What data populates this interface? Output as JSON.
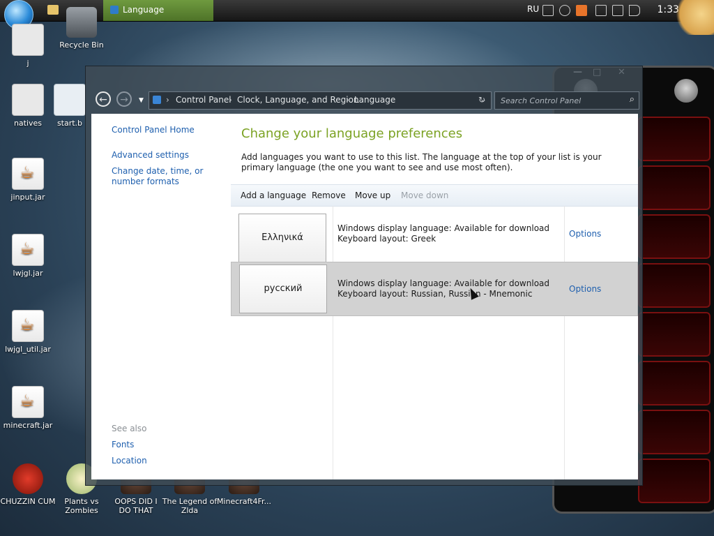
{
  "taskbar": {
    "active_task": "Language",
    "tray_language": "RU",
    "clock": "1:33 AM"
  },
  "desktop": {
    "icons": [
      {
        "label": "j"
      },
      {
        "label": "Recycle Bin"
      },
      {
        "label": "natives"
      },
      {
        "label": "start.b"
      },
      {
        "label": "jinput.jar"
      },
      {
        "label": "lwjgl.jar"
      },
      {
        "label": "lwjgl_util.jar"
      },
      {
        "label": "minecraft.jar"
      },
      {
        "label": "CHUZZIN CUM"
      },
      {
        "label": "Plants vs Zombies"
      },
      {
        "label": "OOPS DID I DO THAT"
      },
      {
        "label": "The Legend of Zlda"
      },
      {
        "label": "Minecraft4Fr..."
      }
    ]
  },
  "window": {
    "nav": {
      "back": "←",
      "forward": "→",
      "recent": "▼"
    },
    "breadcrumb": [
      "Control Panel",
      "Clock, Language, and Region",
      "Language"
    ],
    "search_placeholder": "Search Control Panel",
    "sidebar": {
      "home": "Control Panel Home",
      "advanced": "Advanced settings",
      "change_date": "Change date, time, or number formats",
      "see_also": "See also",
      "fonts": "Fonts",
      "location": "Location"
    },
    "main": {
      "heading": "Change your language preferences",
      "description": "Add languages you want to use to this list. The language at the top of your list is your primary language (the one you want to see and use most often).",
      "toolbar": {
        "add": "Add a language",
        "remove": "Remove",
        "move_up": "Move up",
        "move_down": "Move down"
      },
      "languages": [
        {
          "name": "Ελληνικά",
          "line1": "Windows display language: Available for download",
          "line2": "Keyboard layout: Greek",
          "options": "Options",
          "selected": false
        },
        {
          "name": "русский",
          "line1": "Windows display language: Available for download",
          "line2": "Keyboard layout: Russian, Russian - Mnemonic",
          "options": "Options",
          "selected": true
        }
      ]
    }
  },
  "colors": {
    "heading": "#7ba223",
    "link": "#1e5fae",
    "active_task": "#6f9a3f"
  }
}
